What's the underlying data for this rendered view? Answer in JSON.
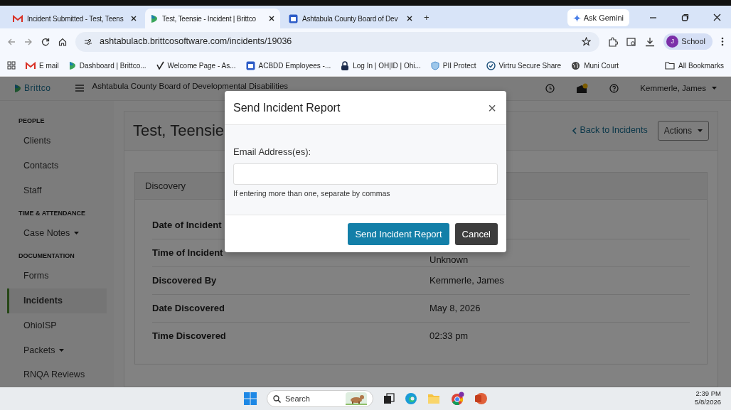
{
  "browser": {
    "tabs": [
      {
        "title": "Incident Submitted - Test, Teens",
        "kind": "mail",
        "selected": false
      },
      {
        "title": "Test, Teensie - Incident | Brittco",
        "kind": "brittco",
        "selected": true
      },
      {
        "title": "Ashtabula County Board of Dev",
        "kind": "calendar",
        "selected": false
      }
    ],
    "new_tab": "+",
    "ask_gemini": "Ask Gemini",
    "address": "ashtabulacb.brittcosoftware.com/incidents/19036",
    "profile": {
      "initial": "J",
      "label": "School"
    },
    "bookmarks": [
      {
        "label": "E mail",
        "kind": "mail"
      },
      {
        "label": "Dashboard | Brittco...",
        "kind": "brittco"
      },
      {
        "label": "Welcome Page - As...",
        "kind": "check"
      },
      {
        "label": "ACBDD Employees -...",
        "kind": "calendar"
      },
      {
        "label": "Log In | OH|ID | Ohi...",
        "kind": "lock"
      },
      {
        "label": "PII Protect",
        "kind": "shield"
      },
      {
        "label": "Virtru Secure Share",
        "kind": "virtru"
      },
      {
        "label": "Muni Court",
        "kind": "globe"
      }
    ],
    "all_bookmarks": "All Bookmarks"
  },
  "app": {
    "brand": "Brittco",
    "organization": "Ashtabula County Board of Developmental Disabilities",
    "user": "Kemmerle, James",
    "has_notification": true,
    "sidebar": [
      {
        "heading": "PEOPLE",
        "items": [
          {
            "label": "Clients",
            "selected": false,
            "dropdown": false
          },
          {
            "label": "Contacts",
            "selected": false,
            "dropdown": false
          },
          {
            "label": "Staff",
            "selected": false,
            "dropdown": false
          }
        ]
      },
      {
        "heading": "TIME & ATTENDANCE",
        "items": [
          {
            "label": "Case Notes",
            "selected": false,
            "dropdown": true
          }
        ]
      },
      {
        "heading": "DOCUMENTATION",
        "items": [
          {
            "label": "Forms",
            "selected": false,
            "dropdown": false
          },
          {
            "label": "Incidents",
            "selected": true,
            "dropdown": false
          },
          {
            "label": "OhioISP",
            "selected": false,
            "dropdown": false
          },
          {
            "label": "Packets",
            "selected": false,
            "dropdown": true
          },
          {
            "label": "RNQA Reviews",
            "selected": false,
            "dropdown": false
          }
        ]
      }
    ],
    "page_title": "Test, Teensie",
    "back_link": "Back to Incidents",
    "actions": "Actions",
    "card_title": "Discovery",
    "rows": [
      {
        "label": "Date of Incident"
      },
      {
        "label": "Time of Incident",
        "value": "Unknown"
      },
      {
        "label": "Discovered By",
        "value": "Kemmerle, James"
      },
      {
        "label": "Date Discovered",
        "value": "May 8, 2026"
      },
      {
        "label": "Time Discovered",
        "value": "02:33 pm"
      }
    ]
  },
  "modal": {
    "title": "Send Incident Report",
    "close": "×",
    "label": "Email Address(es):",
    "help": "If entering more than one, separate by commas",
    "send": "Send Incident Report",
    "cancel": "Cancel"
  },
  "taskbar": {
    "search": "Search",
    "time": "2:39 PM",
    "date": "5/8/2026"
  }
}
